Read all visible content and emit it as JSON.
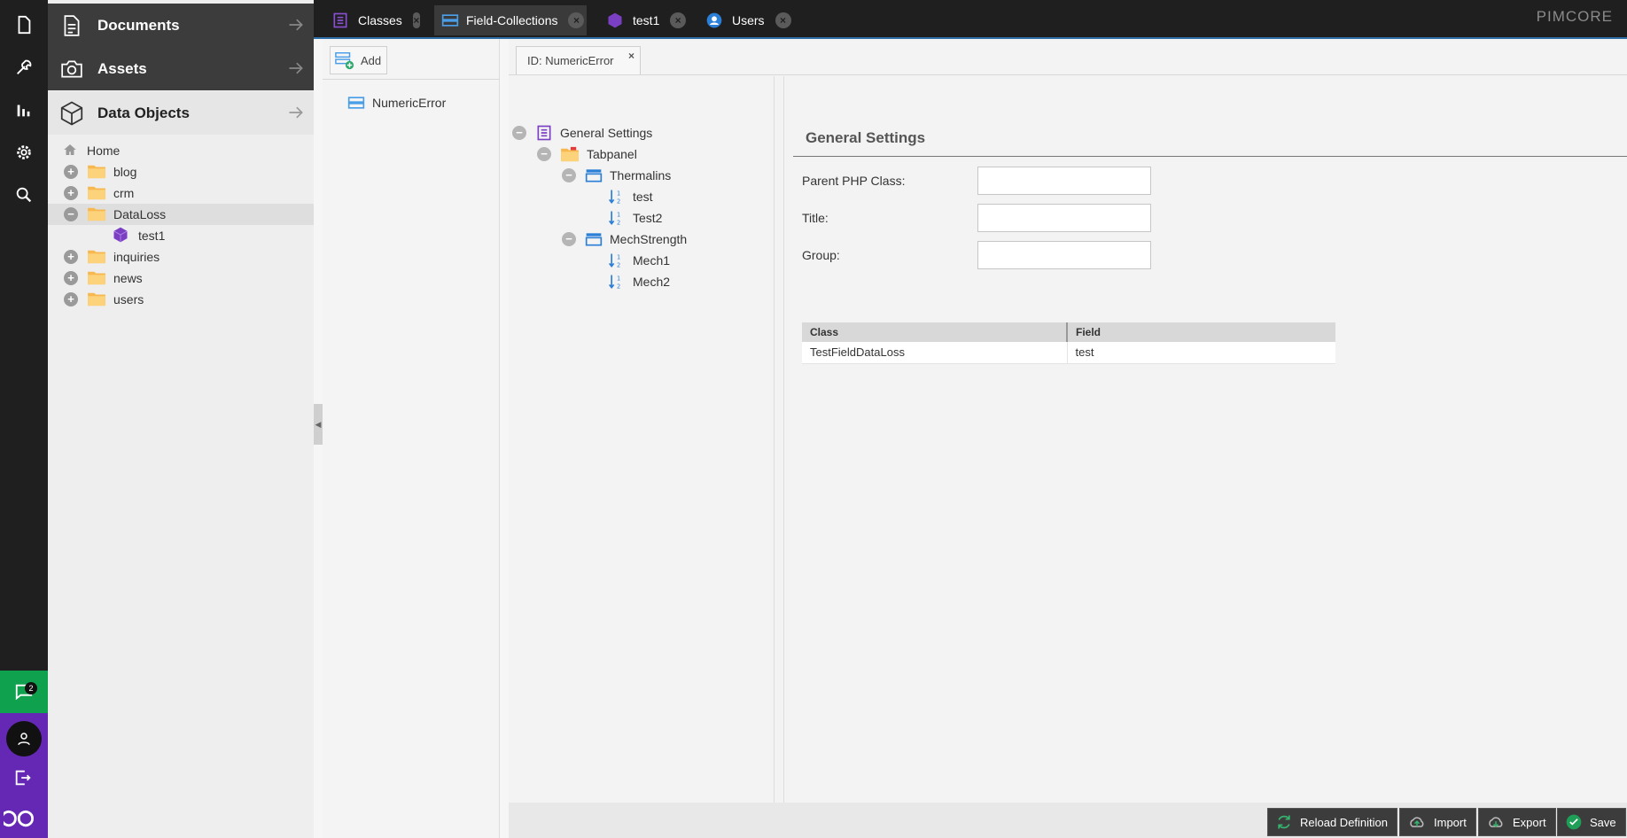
{
  "colors": {
    "rail": "#1f1f1f",
    "accent_green": "#0fa14d",
    "accent_purple": "#6428b4",
    "tab_underline": "#2f6fa8"
  },
  "rail": {
    "notifications_count": "2"
  },
  "left_panel": {
    "sections": [
      {
        "label": "Documents",
        "icon": "document-icon"
      },
      {
        "label": "Assets",
        "icon": "camera-icon"
      },
      {
        "label": "Data Objects",
        "icon": "cube-icon"
      }
    ],
    "tree": [
      {
        "label": "Home",
        "icon": "home-icon"
      },
      {
        "label": "blog",
        "icon": "folder-icon"
      },
      {
        "label": "crm",
        "icon": "folder-icon"
      },
      {
        "label": "DataLoss",
        "icon": "folder-icon"
      },
      {
        "label": "test1",
        "icon": "object-icon"
      },
      {
        "label": "inquiries",
        "icon": "folder-icon"
      },
      {
        "label": "news",
        "icon": "folder-icon"
      },
      {
        "label": "users",
        "icon": "folder-icon"
      }
    ]
  },
  "tabs": [
    {
      "label": "Classes",
      "icon": "classes-icon"
    },
    {
      "label": "Field-Collections",
      "icon": "field-collection-icon"
    },
    {
      "label": "test1",
      "icon": "object-icon"
    },
    {
      "label": "Users",
      "icon": "user-icon"
    }
  ],
  "logo": "PIMCORE",
  "fc_list": {
    "add_label": "Add",
    "items": [
      "NumericError"
    ]
  },
  "editor": {
    "tab_label": "ID: NumericError",
    "structure": [
      {
        "label": "General Settings"
      },
      {
        "label": "Tabpanel"
      },
      {
        "label": "Thermalins"
      },
      {
        "label": "test"
      },
      {
        "label": "Test2"
      },
      {
        "label": "MechStrength"
      },
      {
        "label": "Mech1"
      },
      {
        "label": "Mech2"
      }
    ],
    "settings": {
      "title": "General Settings",
      "parent_php_class_label": "Parent PHP Class:",
      "title_label": "Title:",
      "group_label": "Group:",
      "parent_php_class_value": "",
      "title_value": "",
      "group_value": ""
    },
    "usage_table": {
      "headers": [
        "Class",
        "Field"
      ],
      "rows": [
        [
          "TestFieldDataLoss",
          "test"
        ]
      ]
    },
    "buttons": {
      "reload": "Reload Definition",
      "import": "Import",
      "export": "Export",
      "save": "Save"
    }
  }
}
